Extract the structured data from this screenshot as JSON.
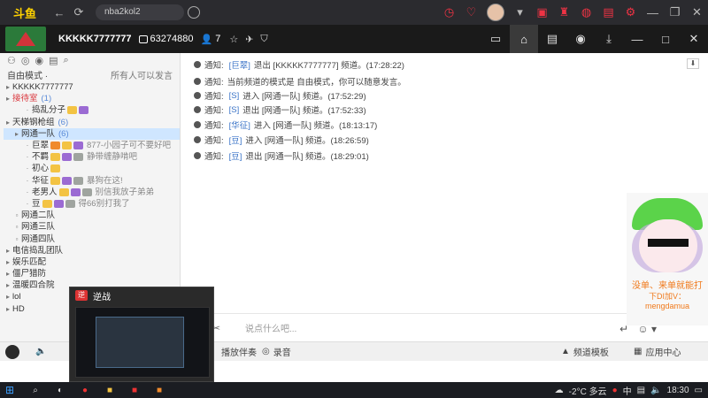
{
  "browser": {
    "logo_text": "斗鱼",
    "url": "nba2kol2"
  },
  "channel": {
    "name": "KKKKK7777777",
    "id": "63274880",
    "online_count": "7"
  },
  "left_panel": {
    "mode_label": "自由模式 ·",
    "mode_right": "所有人可以发言",
    "tree": [
      {
        "label": "KKKKK7777777",
        "indent": 0,
        "type": "top"
      },
      {
        "label": "接待室",
        "count": "(1)",
        "indent": 0,
        "type": "red"
      },
      {
        "label": "捣乱分子",
        "indent": 2,
        "type": "user"
      },
      {
        "label": "天梯钢枪组",
        "count": "(6)",
        "indent": 0,
        "type": "group"
      },
      {
        "label": "网通一队",
        "count": "(6)",
        "indent": 1,
        "type": "selected"
      },
      {
        "label": "巨翠",
        "sig": "877-小园子可不要好吧",
        "indent": 2,
        "type": "user"
      },
      {
        "label": "不羁",
        "sig": "静带缠静啃吧",
        "indent": 2,
        "type": "user"
      },
      {
        "label": "初心",
        "indent": 2,
        "type": "user"
      },
      {
        "label": "华征",
        "sig": "暴狗在这!",
        "indent": 2,
        "type": "user"
      },
      {
        "label": "老男人",
        "sig": "别信我放子弟弟",
        "indent": 2,
        "type": "user"
      },
      {
        "label": "豆",
        "sig": "得66别打我了",
        "indent": 2,
        "type": "user"
      },
      {
        "label": "网通二队",
        "indent": 1,
        "type": "sub"
      },
      {
        "label": "网通三队",
        "indent": 1,
        "type": "sub"
      },
      {
        "label": "网通四队",
        "indent": 1,
        "type": "sub"
      },
      {
        "label": "电信捣乱团队",
        "indent": 0,
        "type": "group"
      },
      {
        "label": "娱乐匹配",
        "indent": 0,
        "type": "group"
      },
      {
        "label": "僵尸猎防",
        "indent": 0,
        "type": "group"
      },
      {
        "label": "温暖四合院",
        "indent": 0,
        "type": "group"
      },
      {
        "label": "lol",
        "indent": 0,
        "type": "group"
      },
      {
        "label": "HD",
        "indent": 0,
        "type": "group"
      }
    ]
  },
  "chat": {
    "messages": [
      {
        "prefix": "通知:",
        "name": "[巨翠]",
        "text": "退出 [KKKKK7777777] 频道。(17:28:22)"
      },
      {
        "prefix": "通知:",
        "name": "",
        "text": "当前频道的模式是 自由模式，你可以随意发言。"
      },
      {
        "prefix": "通知:",
        "name": "[S]",
        "text": "进入 [网通一队] 频道。(17:52:29)"
      },
      {
        "prefix": "通知:",
        "name": "[S]",
        "text": "退出 [网通一队] 频道。(17:52:33)"
      },
      {
        "prefix": "通知:",
        "name": "[华征]",
        "text": "进入 [网通一队] 频道。(18:13:17)"
      },
      {
        "prefix": "通知:",
        "name": "[豆]",
        "text": "进入 [网通一队] 频道。(18:26:59)"
      },
      {
        "prefix": "通知:",
        "name": "[豆]",
        "text": "退出 [网通一队] 频道。(18:29:01)"
      }
    ],
    "input_placeholder": "说点什么吧..."
  },
  "bottom_bar": {
    "music_label": "播放伴奏",
    "record_label": "录音",
    "channel_template": "频道模板",
    "app_center": "应用中心"
  },
  "cam_overlay": {
    "line1": "没单、来单就能打",
    "line2": "下DI加V：mengdamua"
  },
  "preview": {
    "title": "逆战",
    "icon_text": "逆"
  },
  "taskbar": {
    "weather": "-2°C 多云",
    "time": "18:30",
    "lang": "中"
  }
}
